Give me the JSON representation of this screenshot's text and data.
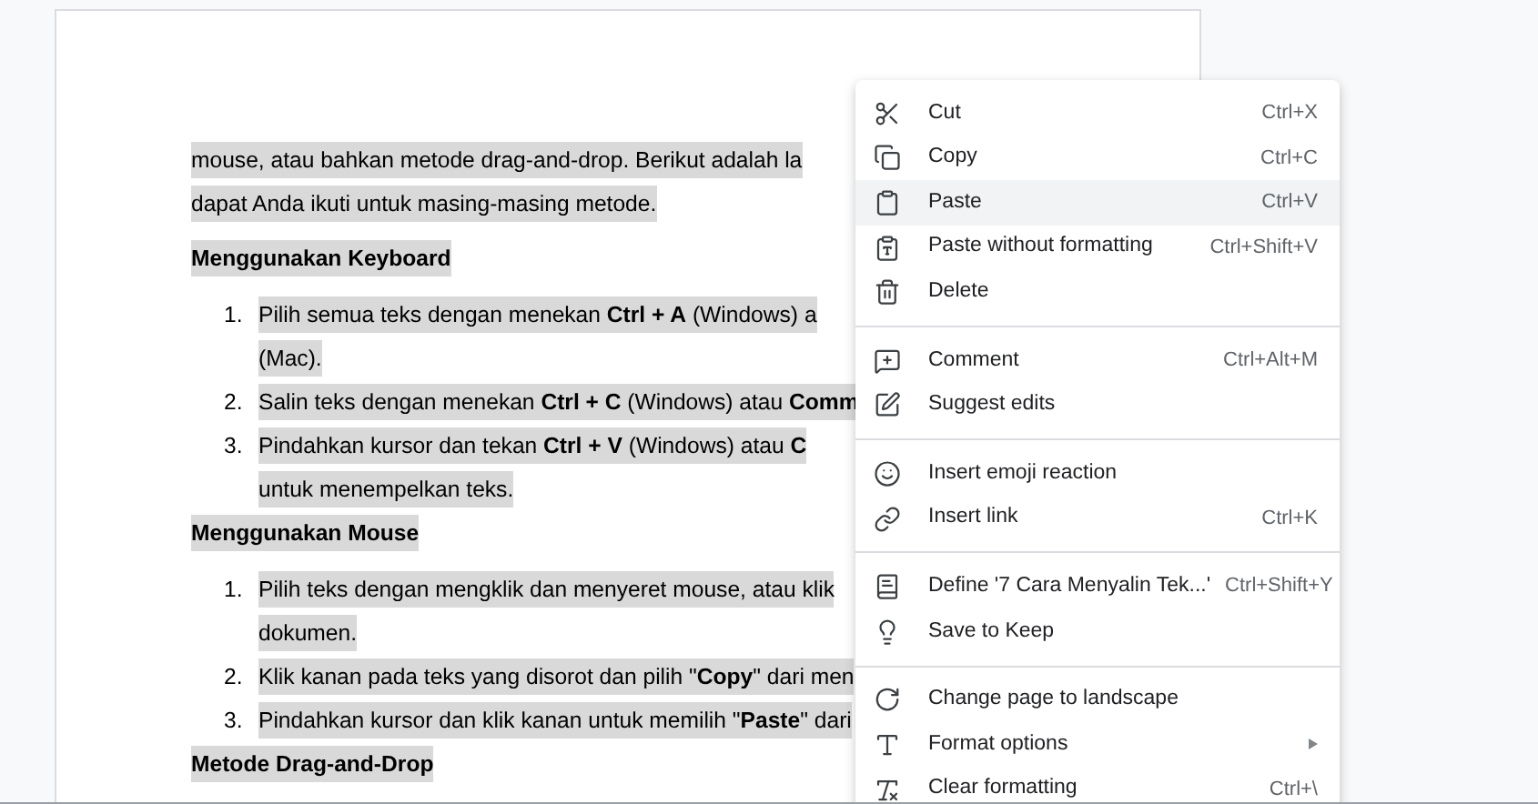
{
  "document": {
    "blocks": [
      {
        "kind": "paragraph",
        "lines": [
          "mouse, atau bahkan metode drag-and-drop. Berikut adalah la",
          "dapat Anda ikuti untuk masing-masing metode."
        ]
      },
      {
        "kind": "heading",
        "lines": [
          "Menggunakan Keyboard"
        ]
      },
      {
        "kind": "item",
        "number": "1.",
        "lines": [
          "Pilih semua teks dengan menekan **Ctrl + A** (Windows) a",
          "(Mac)."
        ]
      },
      {
        "kind": "item",
        "number": "2.",
        "lines": [
          "Salin teks dengan menekan **Ctrl + C** (Windows) atau **Comm**"
        ]
      },
      {
        "kind": "item",
        "number": "3.",
        "lines": [
          "Pindahkan kursor dan tekan **Ctrl + V** (Windows) atau **C**",
          "untuk menempelkan teks."
        ]
      },
      {
        "kind": "heading",
        "lines": [
          "Menggunakan Mouse"
        ]
      },
      {
        "kind": "item",
        "number": "1.",
        "lines": [
          "Pilih teks dengan mengklik dan menyeret mouse, atau klik",
          "dokumen."
        ]
      },
      {
        "kind": "item",
        "number": "2.",
        "lines": [
          "Klik kanan pada teks yang disorot dan pilih \"**Copy**\" dari men"
        ]
      },
      {
        "kind": "item",
        "number": "3.",
        "lines": [
          "Pindahkan kursor dan klik kanan untuk memilih \"**Paste**\" dari"
        ]
      },
      {
        "kind": "heading",
        "lines": [
          "Metode Drag-and-Drop"
        ]
      }
    ]
  },
  "context_menu": {
    "sections": [
      [
        {
          "label": "Cut",
          "shortcut": "Ctrl+X",
          "selected": false
        },
        {
          "label": "Copy",
          "shortcut": "Ctrl+C",
          "selected": false
        },
        {
          "label": "Paste",
          "shortcut": "Ctrl+V",
          "selected": true
        },
        {
          "label": "Paste without formatting",
          "shortcut": "Ctrl+Shift+V",
          "selected": false
        },
        {
          "label": "Delete",
          "selected": false
        }
      ],
      [
        {
          "label": "Comment",
          "shortcut": "Ctrl+Alt+M",
          "selected": false
        },
        {
          "label": "Suggest edits",
          "selected": false
        }
      ],
      [
        {
          "label": "Insert emoji reaction",
          "selected": false
        },
        {
          "label": "Insert link",
          "shortcut": "Ctrl+K",
          "selected": false
        }
      ],
      [
        {
          "label": "Define '7 Cara Menyalin Tek...'",
          "shortcut": "Ctrl+Shift+Y",
          "selected": false
        },
        {
          "label": "Save to Keep",
          "selected": false
        }
      ],
      [
        {
          "label": "Change page to landscape",
          "selected": false
        },
        {
          "label": "Format options",
          "submenu": true,
          "selected": false
        },
        {
          "label": "Clear formatting",
          "shortcut": "Ctrl+\\",
          "selected": false
        }
      ]
    ]
  }
}
